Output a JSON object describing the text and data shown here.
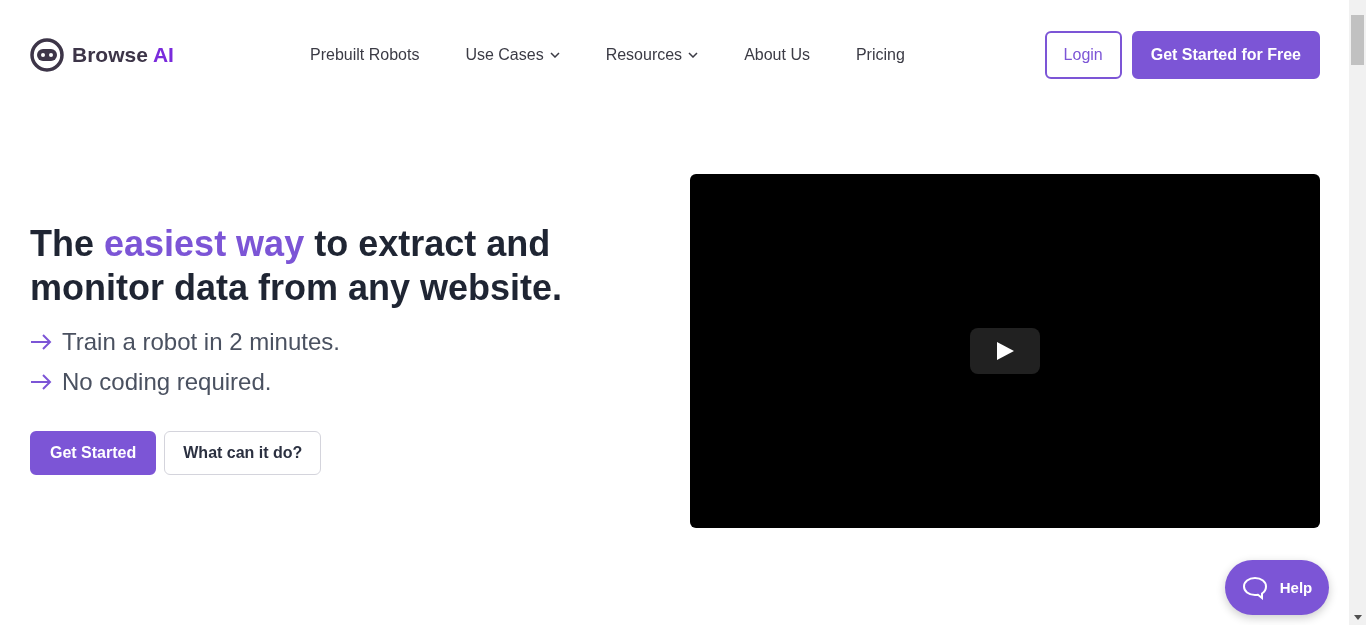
{
  "brand": {
    "name": "Browse",
    "accent": "AI"
  },
  "nav": [
    {
      "label": "Prebuilt Robots",
      "dropdown": false
    },
    {
      "label": "Use Cases",
      "dropdown": true
    },
    {
      "label": "Resources",
      "dropdown": true
    },
    {
      "label": "About Us",
      "dropdown": false
    },
    {
      "label": "Pricing",
      "dropdown": false
    }
  ],
  "header_buttons": [
    {
      "label": "Login",
      "kind": "outline"
    },
    {
      "label": "Get Started for Free",
      "kind": "solid"
    }
  ],
  "hero": {
    "headline": [
      {
        "text": "The ",
        "highlight": false
      },
      {
        "text": "easiest way",
        "highlight": true
      },
      {
        "text": " to extract and monitor data from any website.",
        "highlight": false
      }
    ],
    "points": [
      "Train a robot in 2 minutes.",
      "No coding required."
    ],
    "buttons": [
      {
        "label": "Get Started",
        "kind": "solid"
      },
      {
        "label": "What can it do?",
        "kind": "outline"
      }
    ]
  },
  "help": {
    "label": "Help"
  }
}
